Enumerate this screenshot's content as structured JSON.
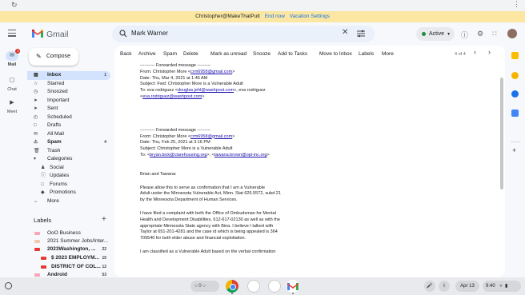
{
  "banner": {
    "text": "Christopher@MakeThatPutt",
    "end_now": "End now",
    "vacation_settings": "Vacation Settings"
  },
  "header": {
    "brand": "Gmail",
    "search_value": "Mark Warner",
    "status": "Active"
  },
  "rail": {
    "mail": "Mail",
    "mail_badge": "1",
    "chat": "Chat",
    "meet": "Meet"
  },
  "compose": "Compose",
  "nav": [
    {
      "label": "Inbox",
      "count": "1",
      "icon": "inbox-icon"
    },
    {
      "label": "Starred",
      "count": "",
      "icon": "star-icon"
    },
    {
      "label": "Snoozed",
      "count": "",
      "icon": "clock-icon"
    },
    {
      "label": "Important",
      "count": "",
      "icon": "important-icon"
    },
    {
      "label": "Sent",
      "count": "",
      "icon": "send-icon"
    },
    {
      "label": "Scheduled",
      "count": "",
      "icon": "scheduled-icon"
    },
    {
      "label": "Drafts",
      "count": "",
      "icon": "draft-icon"
    },
    {
      "label": "All Mail",
      "count": "",
      "icon": "all-mail-icon"
    },
    {
      "label": "Spam",
      "count": "4",
      "icon": "spam-icon"
    },
    {
      "label": "Trash",
      "count": "",
      "icon": "trash-icon"
    },
    {
      "label": "Categories",
      "count": "",
      "icon": "label-icon"
    }
  ],
  "categories": [
    {
      "label": "Social",
      "icon": "social-icon"
    },
    {
      "label": "Updates",
      "icon": "updates-icon"
    },
    {
      "label": "Forums",
      "icon": "forums-icon"
    },
    {
      "label": "Promotions",
      "icon": "promotions-icon"
    }
  ],
  "more": "More",
  "labels_heading": "Labels",
  "labels": [
    {
      "label": "OoO Business",
      "count": "",
      "color": "#f6a6b7",
      "bold": false
    },
    {
      "label": "2021 Summer Jobs/Inter...",
      "count": "",
      "color": "#f5c8b5",
      "bold": false
    },
    {
      "label": "2023Washington, ...",
      "count": "22",
      "color": "#e53935",
      "bold": true
    },
    {
      "label": "$ 2023 EMPLOYM...",
      "count": "15",
      "color": "#e53935",
      "bold": true
    },
    {
      "label": "DISTRICT OF COL...",
      "count": "12",
      "color": "#e53935",
      "bold": true
    },
    {
      "label": "Android",
      "count": "53",
      "color": "#f6a6b7",
      "bold": true
    }
  ],
  "toolbar": {
    "back": "Back",
    "archive": "Archive",
    "spam": "Spam",
    "delete": "Delete",
    "mark_unread": "Mark as unread",
    "snooze": "Snooze",
    "add_tasks": "Add to Tasks",
    "move_inbox": "Move to Inbox",
    "labels": "Labels",
    "more": "More",
    "page": "4 of 4"
  },
  "message": {
    "fwd1": {
      "header": "---------- Forwarded message ---------",
      "from_pre": "From: Christopher More <",
      "from_email": "crm6958@gmail.com",
      "from_post": ">",
      "date": "Date: Thu, Mar 4, 2021 at 1:46 AM",
      "subject": "Subject: Fwd: Christopher More is a Vulnerable Adult",
      "to_pre": "To: eva rodriguez <",
      "to_email1": "douglas.jehl@washpost.com",
      "to_mid": ">, eva rodriguez",
      "to_email2_pre": "<",
      "to_email2": "eva.rodriguez@washpost.com",
      "to_email2_post": ">"
    },
    "fwd2": {
      "header": "---------- Forwarded message ---------",
      "from_pre": "From: Christopher More <",
      "from_email": "crm6958@gmail.com",
      "from_post": ">",
      "date": "Date: Thu, Feb 25, 2021 at 3:16 PM",
      "subject": "Subject: Christopher More is a Vulnerable Adult",
      "to_pre": "To: <",
      "to_email1": "bryan.bick@clarehousing.org",
      "to_mid": ">, <",
      "to_email2": "tawana.brown@opi-inc.org",
      "to_post": ">"
    },
    "greeting": "Brian and Tawana:",
    "p1": [
      "Please allow this to serve as confirmation that I am a Vulnerable",
      "Adult under the Minnesota Vulnerable Act, Minn. Stat 626.5572, subd 21",
      "by the Minnesota Department of Human Services."
    ],
    "p2": [
      "I have filed a complaint with both the Office of Ombudsman for Mental",
      "Health and Development Disabilities, 612-617-02130 as well as with the",
      "appropriate Minnesota State agency with Bina.  I believe I talked with",
      "Taylor at 651-201-4281 and the case id which is being appealed is 364",
      "709540 for both elder abuse and financial exploitation."
    ],
    "p3": [
      "I am classified as a Vulnerable Adult based on the verbal confirmation"
    ]
  },
  "shelf": {
    "tray_count": "0",
    "date": "Apr 13",
    "time": "9:40"
  }
}
